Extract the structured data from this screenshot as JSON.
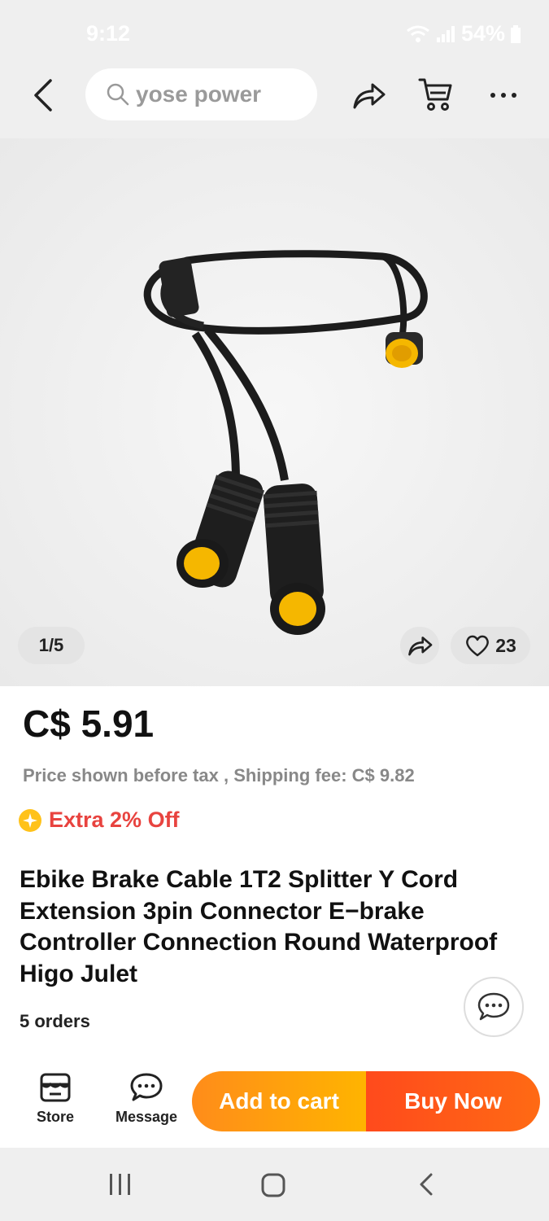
{
  "status_bar": {
    "time": "9:12",
    "battery": "54%"
  },
  "header": {
    "search_placeholder": "yose power",
    "icons": [
      "back-arrow-icon",
      "search-icon",
      "share-icon",
      "cart-icon",
      "more-icon"
    ]
  },
  "gallery": {
    "page_indicator": "1/5",
    "like_count": "23",
    "icons": [
      "share-icon",
      "heart-icon"
    ]
  },
  "product": {
    "price": "C$ 5.91",
    "tax_note": "Price shown before tax , Shipping fee: C$ 9.82",
    "promo": "Extra 2% Off",
    "title": "Ebike Brake Cable 1T2 Splitter Y Cord Extension 3pin Connector E−brake Controller Connection  Round Waterproof Higo Julet",
    "orders": "5 orders"
  },
  "bottom_bar": {
    "store_label": "Store",
    "message_label": "Message",
    "add_to_cart_label": "Add to cart",
    "buy_now_label": "Buy Now"
  },
  "colors": {
    "price_text": "#111111",
    "promo_red": "#e8433f",
    "add_to_cart_orange": "#ff9a12",
    "buy_now_orange_red": "#ff5419",
    "connector_yellow": "#f5b700"
  }
}
